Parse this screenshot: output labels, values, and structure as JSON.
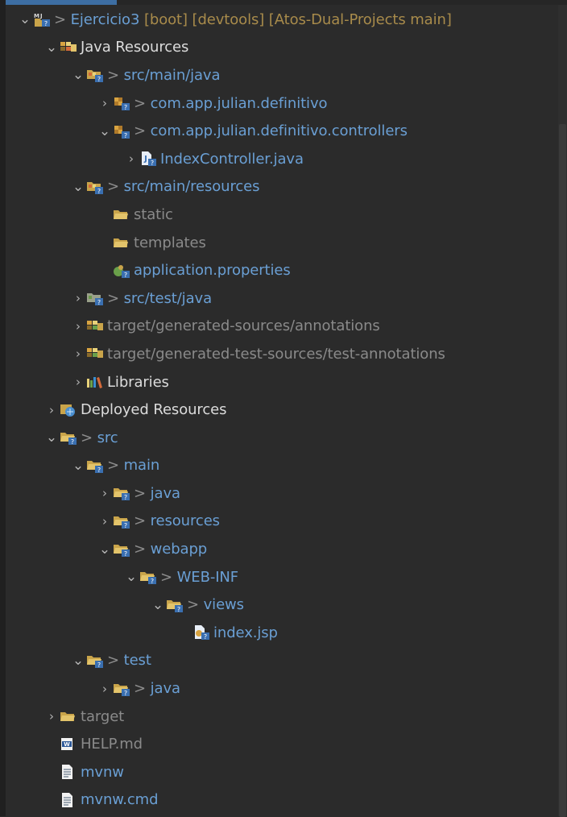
{
  "tree": [
    {
      "depth": 0,
      "twisty": "expanded",
      "icon": "maven-project-icon",
      "prefix": ">",
      "name": "Ejercicio3",
      "deco": "[boot] [devtools] [Atos-Dual-Projects main]",
      "color": "blue"
    },
    {
      "depth": 1,
      "twisty": "expanded",
      "icon": "java-resources-icon",
      "prefix": "",
      "name": "Java Resources",
      "color": "white"
    },
    {
      "depth": 2,
      "twisty": "expanded",
      "icon": "source-folder-icon",
      "prefix": ">",
      "name": "src/main/java",
      "color": "blue"
    },
    {
      "depth": 3,
      "twisty": "collapsed",
      "icon": "package-icon",
      "prefix": ">",
      "name": "com.app.julian.definitivo",
      "color": "blue"
    },
    {
      "depth": 3,
      "twisty": "expanded",
      "icon": "package-icon",
      "prefix": ">",
      "name": "com.app.julian.definitivo.controllers",
      "color": "blue"
    },
    {
      "depth": 4,
      "twisty": "collapsed",
      "icon": "java-file-icon",
      "prefix": "",
      "name": "IndexController.java",
      "color": "blue"
    },
    {
      "depth": 2,
      "twisty": "expanded",
      "icon": "source-folder-icon",
      "prefix": ">",
      "name": "src/main/resources",
      "color": "blue"
    },
    {
      "depth": 3,
      "twisty": "none",
      "icon": "folder-icon",
      "prefix": "",
      "name": "static",
      "color": "gray"
    },
    {
      "depth": 3,
      "twisty": "none",
      "icon": "folder-icon",
      "prefix": "",
      "name": "templates",
      "color": "gray"
    },
    {
      "depth": 3,
      "twisty": "none",
      "icon": "properties-file-icon",
      "prefix": "",
      "name": "application.properties",
      "color": "blue"
    },
    {
      "depth": 2,
      "twisty": "collapsed",
      "icon": "test-source-folder-icon",
      "prefix": ">",
      "name": "src/test/java",
      "color": "blue"
    },
    {
      "depth": 2,
      "twisty": "collapsed",
      "icon": "generated-sources-icon",
      "prefix": "",
      "name": "target/generated-sources/annotations",
      "color": "gray"
    },
    {
      "depth": 2,
      "twisty": "collapsed",
      "icon": "generated-sources-icon",
      "prefix": "",
      "name": "target/generated-test-sources/test-annotations",
      "color": "gray"
    },
    {
      "depth": 2,
      "twisty": "collapsed",
      "icon": "libraries-icon",
      "prefix": "",
      "name": "Libraries",
      "color": "white"
    },
    {
      "depth": 1,
      "twisty": "collapsed",
      "icon": "deployed-resources-icon",
      "prefix": "",
      "name": "Deployed Resources",
      "color": "white"
    },
    {
      "depth": 1,
      "twisty": "expanded",
      "icon": "folder-repo-icon",
      "prefix": ">",
      "name": "src",
      "color": "blue"
    },
    {
      "depth": 2,
      "twisty": "expanded",
      "icon": "folder-repo-icon",
      "prefix": ">",
      "name": "main",
      "color": "blue"
    },
    {
      "depth": 3,
      "twisty": "collapsed",
      "icon": "folder-repo-icon",
      "prefix": ">",
      "name": "java",
      "color": "blue"
    },
    {
      "depth": 3,
      "twisty": "collapsed",
      "icon": "folder-repo-icon",
      "prefix": ">",
      "name": "resources",
      "color": "blue"
    },
    {
      "depth": 3,
      "twisty": "expanded",
      "icon": "folder-repo-icon",
      "prefix": ">",
      "name": "webapp",
      "color": "blue"
    },
    {
      "depth": 4,
      "twisty": "expanded",
      "icon": "folder-repo-icon",
      "prefix": ">",
      "name": "WEB-INF",
      "color": "blue"
    },
    {
      "depth": 5,
      "twisty": "expanded",
      "icon": "folder-repo-icon",
      "prefix": ">",
      "name": "views",
      "color": "blue"
    },
    {
      "depth": 6,
      "twisty": "none",
      "icon": "jsp-file-icon",
      "prefix": "",
      "name": "index.jsp",
      "color": "blue"
    },
    {
      "depth": 2,
      "twisty": "expanded",
      "icon": "folder-repo-icon",
      "prefix": ">",
      "name": "test",
      "color": "blue"
    },
    {
      "depth": 3,
      "twisty": "collapsed",
      "icon": "folder-repo-icon",
      "prefix": ">",
      "name": "java",
      "color": "blue"
    },
    {
      "depth": 1,
      "twisty": "collapsed",
      "icon": "folder-icon",
      "prefix": "",
      "name": "target",
      "color": "gray"
    },
    {
      "depth": 1,
      "twisty": "none",
      "icon": "markdown-file-icon",
      "prefix": "",
      "name": "HELP.md",
      "color": "gray"
    },
    {
      "depth": 1,
      "twisty": "none",
      "icon": "text-file-icon",
      "prefix": "",
      "name": "mvnw",
      "color": "blue"
    },
    {
      "depth": 1,
      "twisty": "none",
      "icon": "text-file-icon",
      "prefix": "",
      "name": "mvnw.cmd",
      "color": "blue"
    }
  ],
  "colors": {
    "blue": "#6a9fd4",
    "white": "#dcdcdc",
    "gray": "#8a8a8a",
    "olive": "#a88b4b",
    "background": "#2b2b2b"
  }
}
